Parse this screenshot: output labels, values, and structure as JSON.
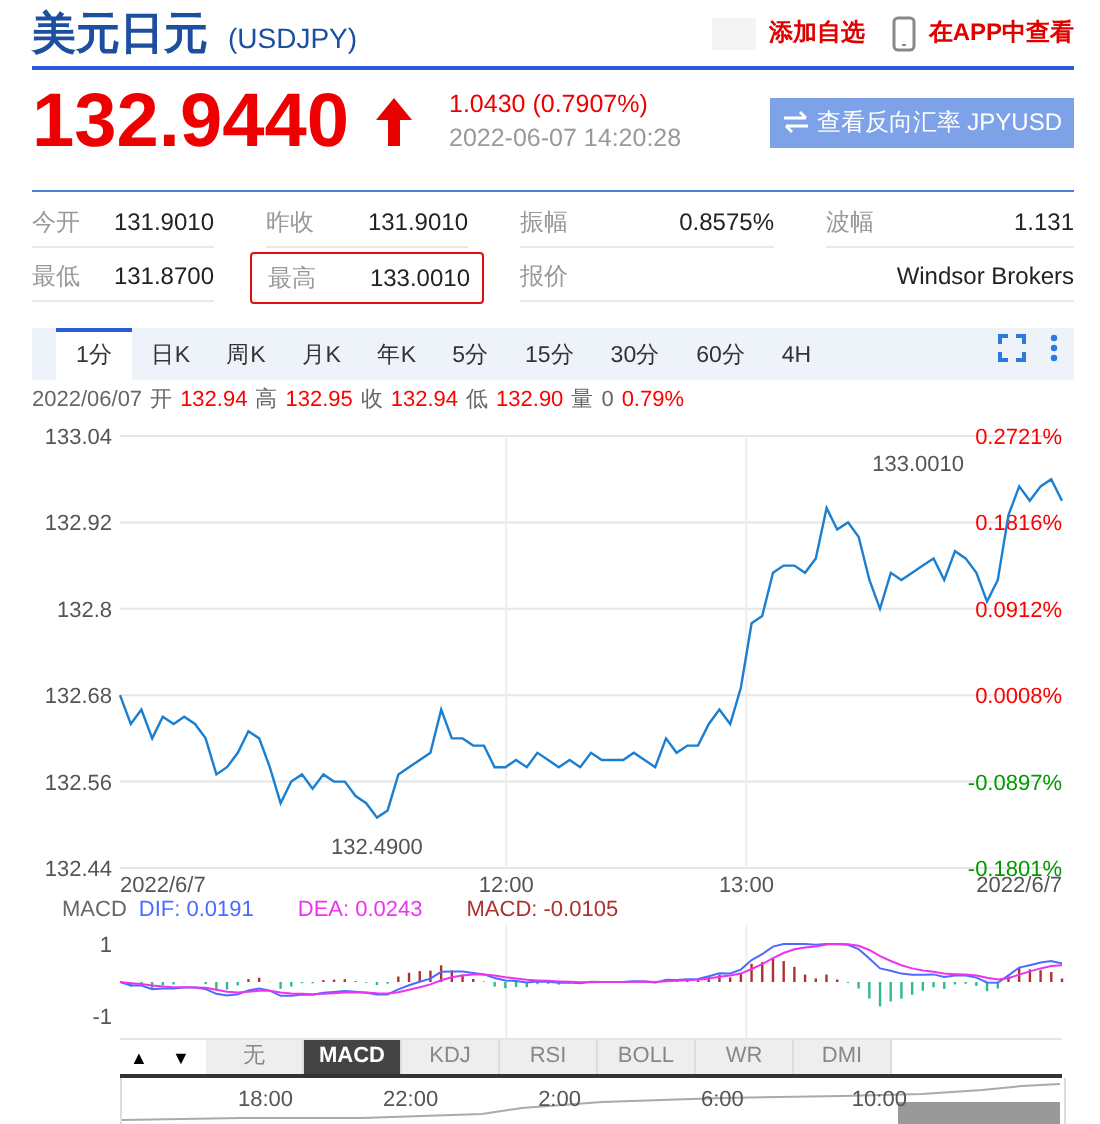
{
  "header": {
    "title": "美元日元",
    "code": "(USDJPY)",
    "watch_link": "添加自选",
    "app_link": "在APP中查看"
  },
  "quote": {
    "price": "132.9440",
    "rising": true,
    "change": "1.0430 (0.7907%)",
    "time": "2022-06-07 14:20:28",
    "reverse_button": "查看反向汇率 JPYUSD"
  },
  "stats": [
    {
      "label": "今开",
      "value": "131.9010",
      "highlighted": false
    },
    {
      "label": "昨收",
      "value": "131.9010",
      "highlighted": false
    },
    {
      "label": "振幅",
      "value": "0.8575%",
      "highlighted": false
    },
    {
      "label": "波幅",
      "value": "1.131",
      "highlighted": false
    },
    {
      "label": "最低",
      "value": "131.8700",
      "highlighted": false
    },
    {
      "label": "最高",
      "value": "133.0010",
      "highlighted": true
    },
    {
      "label": "报价",
      "value": "Windsor Brokers",
      "highlighted": false
    }
  ],
  "period_tabs": [
    {
      "label": "1分",
      "selected": true
    },
    {
      "label": "日K",
      "selected": false
    },
    {
      "label": "周K",
      "selected": false
    },
    {
      "label": "月K",
      "selected": false
    },
    {
      "label": "年K",
      "selected": false
    },
    {
      "label": "5分",
      "selected": false
    },
    {
      "label": "15分",
      "selected": false
    },
    {
      "label": "30分",
      "selected": false
    },
    {
      "label": "60分",
      "selected": false
    },
    {
      "label": "4H",
      "selected": false
    }
  ],
  "ohlc_date": "2022/06/07",
  "ohlc": [
    {
      "label": "开",
      "value": "132.94",
      "color": "#ff0000"
    },
    {
      "label": "高",
      "value": "132.95",
      "color": "#ff0000"
    },
    {
      "label": "收",
      "value": "132.94",
      "color": "#ff0000"
    },
    {
      "label": "低",
      "value": "132.90",
      "color": "#ff0000"
    },
    {
      "label": "量",
      "value": "0",
      "color": "#666666"
    }
  ],
  "ohlc_change": "0.79%",
  "price_chart": {
    "chart_data": {
      "type": "line",
      "grid": true,
      "ylim": [
        132.44,
        133.04
      ],
      "yticks": [
        {
          "value": 132.44,
          "label": "132.44"
        },
        {
          "value": 132.56,
          "label": "132.56"
        },
        {
          "value": 132.68,
          "label": "132.68"
        },
        {
          "value": 132.8,
          "label": "132.8"
        },
        {
          "value": 132.92,
          "label": "132.92"
        },
        {
          "value": 133.04,
          "label": "133.04"
        }
      ],
      "series": [
        {
          "color": "#1a7fd0",
          "values": [
            132.68,
            132.64,
            132.66,
            132.62,
            132.65,
            132.64,
            132.65,
            132.64,
            132.62,
            132.57,
            132.58,
            132.6,
            132.63,
            132.62,
            132.58,
            132.53,
            132.56,
            132.57,
            132.55,
            132.57,
            132.56,
            132.56,
            132.54,
            132.53,
            132.51,
            132.52,
            132.57,
            132.58,
            132.59,
            132.6,
            132.66,
            132.62,
            132.62,
            132.61,
            132.61,
            132.58,
            132.58,
            132.59,
            132.58,
            132.6,
            132.59,
            132.58,
            132.59,
            132.58,
            132.6,
            132.59,
            132.59,
            132.59,
            132.6,
            132.59,
            132.58,
            132.62,
            132.6,
            132.61,
            132.61,
            132.64,
            132.66,
            132.64,
            132.69,
            132.78,
            132.79,
            132.85,
            132.86,
            132.86,
            132.85,
            132.87,
            132.94,
            132.91,
            132.92,
            132.9,
            132.84,
            132.8,
            132.85,
            132.84,
            132.85,
            132.86,
            132.87,
            132.84,
            132.88,
            132.87,
            132.85,
            132.81,
            132.84,
            132.93,
            132.97,
            132.95,
            132.97,
            132.98,
            132.95
          ]
        }
      ],
      "annotations": [
        "133.0010",
        "132.4900"
      ]
    },
    "time_labels": [
      "2022/6/7",
      "12:00",
      "13:00",
      "2022/6/7"
    ],
    "percent_ticks": [
      {
        "label": "0.2721%",
        "color": "#ff0000"
      },
      {
        "label": "0.1816%",
        "color": "#ff0000"
      },
      {
        "label": "0.0912%",
        "color": "#ff0000"
      },
      {
        "label": "0.0008%",
        "color": "#ff0000"
      },
      {
        "label": "-0.0897%",
        "color": "#009900"
      },
      {
        "label": "-0.1801%",
        "color": "#009900"
      }
    ]
  },
  "macd": {
    "legend": [
      {
        "text": "MACD",
        "color": "#666666"
      },
      {
        "text": "DIF: 0.0191",
        "color": "#4d6bff"
      },
      {
        "text": "DEA: 0.0243",
        "color": "#ee33ee"
      },
      {
        "text": "MACD: -0.0105",
        "color": "#b03030"
      }
    ],
    "axis": [
      "1",
      "-1"
    ]
  },
  "indicator_arrows": [
    "▲",
    "▼"
  ],
  "indicator_tabs": [
    {
      "label": "无",
      "selected": false
    },
    {
      "label": "MACD",
      "selected": true
    },
    {
      "label": "KDJ",
      "selected": false
    },
    {
      "label": "RSI",
      "selected": false
    },
    {
      "label": "BOLL",
      "selected": false
    },
    {
      "label": "WR",
      "selected": false
    },
    {
      "label": "DMI",
      "selected": false
    }
  ],
  "navigator": {
    "times": [
      "18:00",
      "22:00",
      "2:00",
      "6:00",
      "10:00"
    ]
  }
}
